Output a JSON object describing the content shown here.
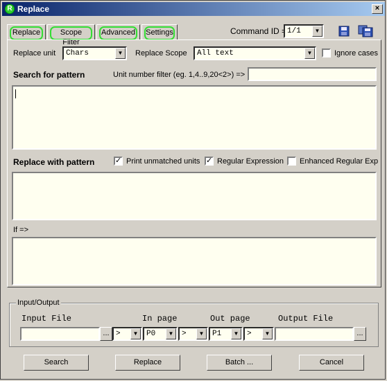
{
  "window": {
    "title": "Replace",
    "close": "×"
  },
  "tabs": [
    {
      "label": "Replace"
    },
    {
      "label": "Scope Filter"
    },
    {
      "label": "Advanced"
    },
    {
      "label": "Settings"
    }
  ],
  "command": {
    "label": "Command ID =>",
    "value": "1/1"
  },
  "replace": {
    "unit_label": "Replace unit",
    "unit_value": "Chars",
    "scope_label": "Replace Scope",
    "scope_value": "All text",
    "ignore_cases": "Ignore cases",
    "search_heading": "Search for pattern",
    "unit_filter_label": "Unit number filter (eg. 1,4..9,20<2>) =>",
    "unit_filter_value": "",
    "search_text": "",
    "replace_heading": "Replace with pattern",
    "print_unmatched": "Print unmatched units",
    "regular_expression": "Regular Expression",
    "enhanced_regexp": "Enhanced Regular Exp",
    "replace_text": "",
    "if_label": "If =>",
    "if_text": ""
  },
  "checks": {
    "ignore_cases": false,
    "print_unmatched": true,
    "regular_expression": true,
    "enhanced_regexp": false
  },
  "io": {
    "group_title": "Input/Output",
    "input_file_label": "Input File",
    "in_page_label": "In page",
    "out_page_label": "Out page",
    "output_file_label": "Output File",
    "input_file": "",
    "arrow1": ">",
    "in_page": "P0",
    "arrow2": ">",
    "out_page": "P1",
    "arrow3": ">",
    "output_file": "",
    "browse": "..."
  },
  "buttons": {
    "search": "Search",
    "replace": "Replace",
    "batch": "Batch ...",
    "cancel": "Cancel"
  }
}
